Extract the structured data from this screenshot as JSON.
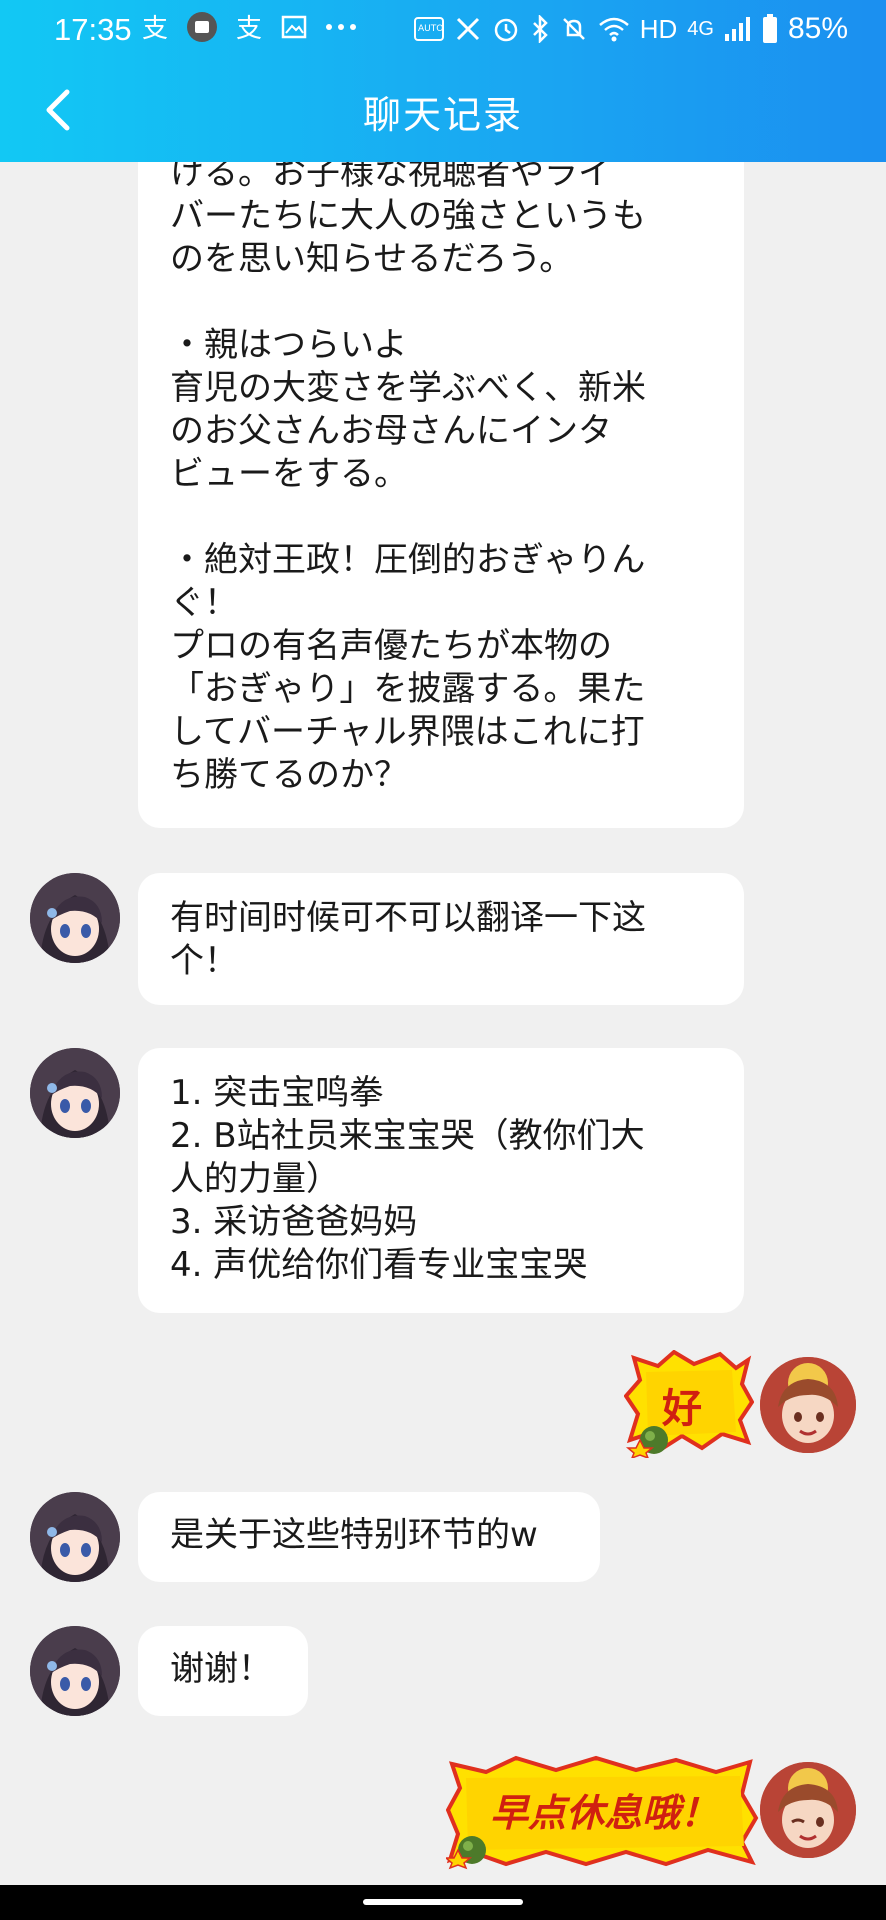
{
  "status": {
    "time": "17:35",
    "network": "HD",
    "signal_type": "4G",
    "battery": "85%"
  },
  "header": {
    "title": "聊天记录",
    "back_icon": "chevron-left-icon"
  },
  "messages": [
    {
      "from": "other",
      "text": "ける。お子様な視聴者やライ\nバーたちに大人の強さというも\nのを思い知らせるだろう。\n\n・親はつらいよ\n育児の大変さを学ぶべく、新米\nのお父さんお母さんにインタ\nビューをする。\n\n・絶対王政！圧倒的おぎゃりん\nぐ！\nプロの有名声優たちが本物の\n「おぎゃり」を披露する。果た\nしてバーチャル界隈はこれに打\nち勝てるのか？"
    },
    {
      "from": "other",
      "text": "有时间时候可不可以翻译一下这\n个！"
    },
    {
      "from": "other",
      "text": "1. 突击宝鸣拳\n2. B站社员来宝宝哭（教你们大\n人的力量）\n3. 采访爸爸妈妈\n4. 声优给你们看专业宝宝哭"
    },
    {
      "from": "self",
      "sticker_text": "好"
    },
    {
      "from": "other",
      "text": "是关于这些特别环节的w"
    },
    {
      "from": "other",
      "text": "谢谢！"
    },
    {
      "from": "self",
      "sticker_text": "早点休息哦！"
    }
  ],
  "colors": {
    "header_start": "#12c8f4",
    "header_end": "#1b8ff0",
    "chat_bg": "#f0f0f0",
    "bubble": "#ffffff",
    "sticker_yellow": "#ffe100",
    "sticker_border": "#e0301e"
  }
}
